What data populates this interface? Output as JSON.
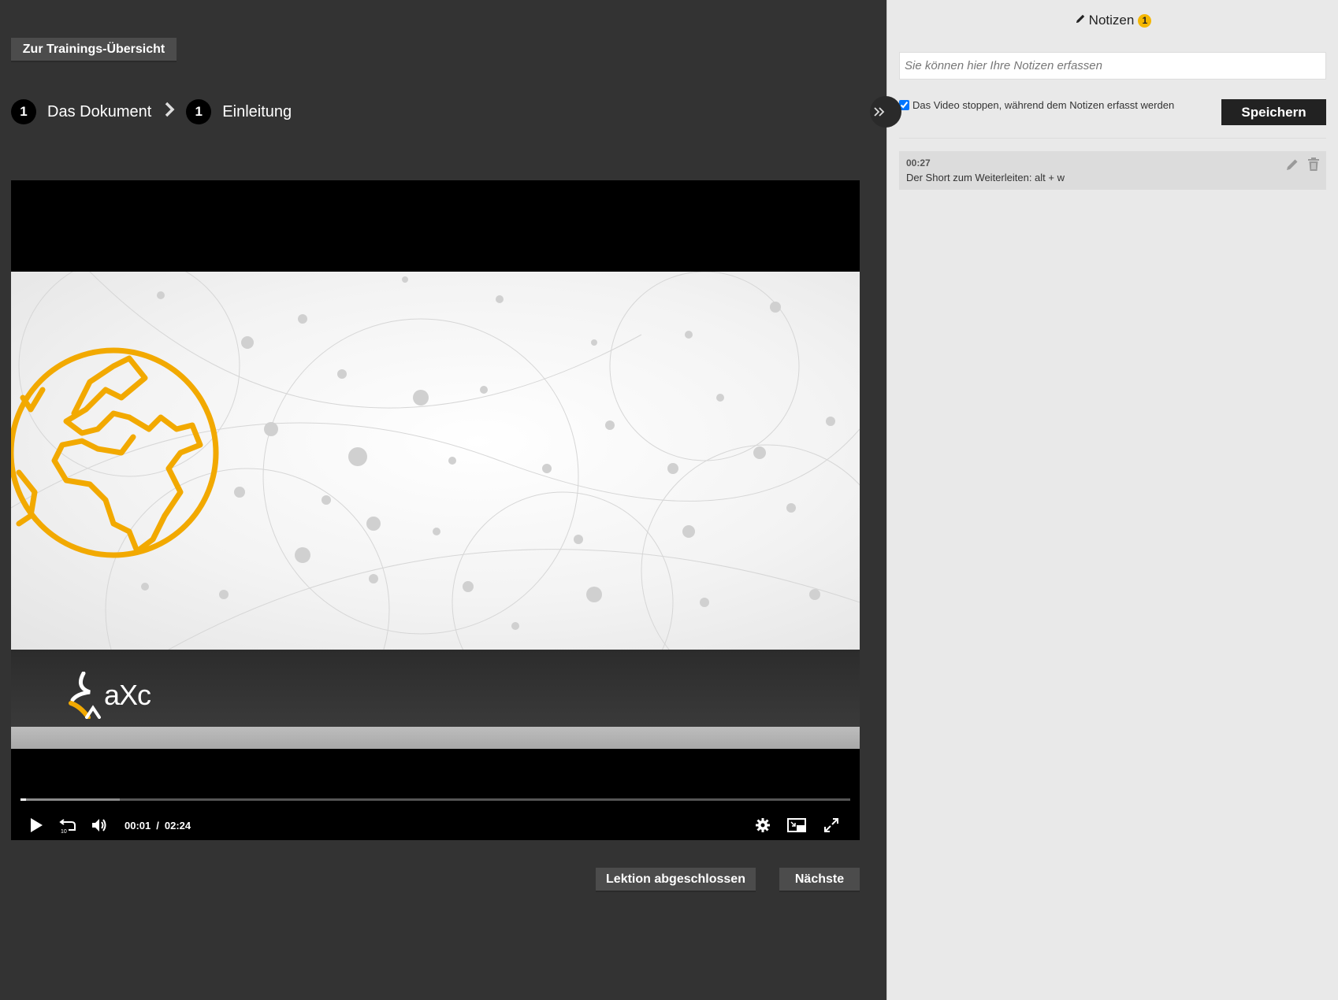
{
  "header": {
    "overview_button": "Zur Trainings-Übersicht"
  },
  "breadcrumb": [
    {
      "number": "1",
      "label": "Das Dokument"
    },
    {
      "number": "1",
      "label": "Einleitung"
    }
  ],
  "video": {
    "logo_text": "aXc",
    "current_time": "00:01",
    "separator": "/",
    "duration": "02:24",
    "played_fraction": 0.007,
    "buffered_fraction": 0.12
  },
  "footer": {
    "lesson_done_button": "Lektion abgeschlossen",
    "next_button": "Nächste"
  },
  "notes": {
    "title": "Notizen",
    "count": "1",
    "input_placeholder": "Sie können hier Ihre Notizen erfassen",
    "stop_video_label": "Das Video stoppen, während dem Notizen erfasst werden",
    "stop_video_checked": true,
    "save_button": "Speichern",
    "items": [
      {
        "time": "00:27",
        "text": "Der Short zum Weiterleiten: alt + w"
      }
    ]
  },
  "colors": {
    "background": "#333333",
    "panel": "#e9e9e9",
    "accent_yellow": "#f5b700",
    "globe_orange": "#f2a900"
  },
  "icons": [
    "pencil-icon",
    "chevron-right-icon",
    "double-chevron-icon",
    "play-icon",
    "replay-10-icon",
    "volume-icon",
    "gear-icon",
    "picture-in-picture-icon",
    "fullscreen-icon",
    "edit-icon",
    "trash-icon"
  ]
}
